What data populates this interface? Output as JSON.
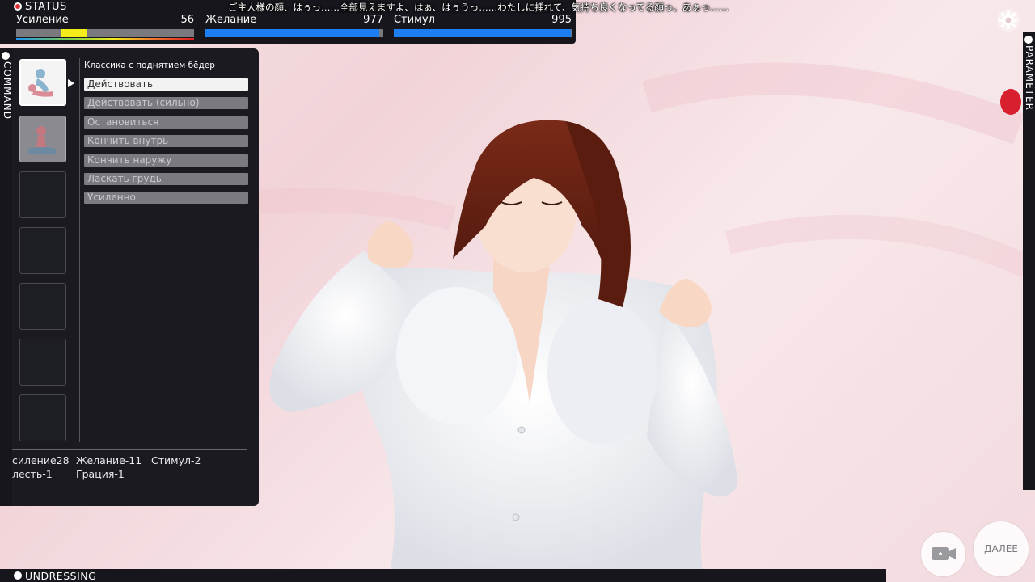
{
  "status": {
    "header": "STATUS",
    "stats": [
      {
        "label": "Усиление",
        "value": "56",
        "fill": 0.56
      },
      {
        "label": "Желание",
        "value": "977",
        "fill": 0.977
      },
      {
        "label": "Стимул",
        "value": "995",
        "fill": 0.995
      }
    ]
  },
  "subtitle": "ご主人様の顔、はぅっ……全部見えますよ、はぁ、はぅうっ……わたしに挿れて、気持ち良くなってる顔っ、あぁっ……",
  "command": {
    "tab_label": "COMMAND",
    "section_title": "Классика с поднятием бёдер",
    "buttons": [
      "Действовать",
      "Действовать (сильно)",
      "Остановиться",
      "Кончить внутрь",
      "Кончить наружу",
      "Ласкать грудь",
      "Усиленно"
    ],
    "effects_row1": [
      "силение28",
      "Желание-11",
      "Стимул-2"
    ],
    "effects_row2": [
      "лесть-1",
      "Грация-1"
    ]
  },
  "parameter": {
    "tab_label": "PARAMETER"
  },
  "undressing": {
    "label": "UNDRESSING"
  },
  "next_button": {
    "label": "ДАЛЕЕ"
  },
  "icons": [
    "settings-gear-icon",
    "camera-icon",
    "record-dot-icon",
    "pointer-arrow-icon"
  ],
  "colors": {
    "panel": "#1a1a20",
    "bar_fill": "#1c7ef0",
    "highlight": "#f4ec1a"
  }
}
